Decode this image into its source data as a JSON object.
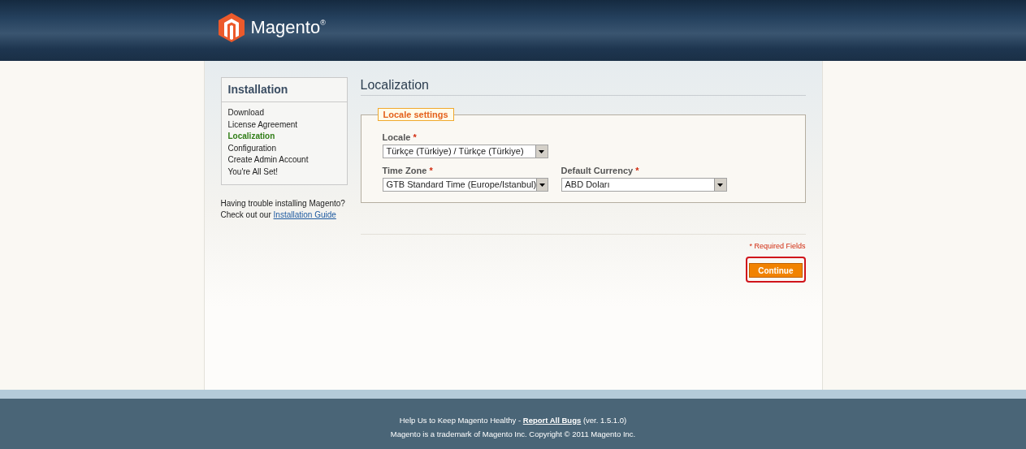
{
  "header": {
    "logo_text": "Magento",
    "logo_mark": "®"
  },
  "sidebar": {
    "title": "Installation",
    "steps": [
      {
        "label": "Download",
        "selected": false
      },
      {
        "label": "License Agreement",
        "selected": false
      },
      {
        "label": "Localization",
        "selected": true
      },
      {
        "label": "Configuration",
        "selected": false
      },
      {
        "label": "Create Admin Account",
        "selected": false
      },
      {
        "label": "You're All Set!",
        "selected": false
      }
    ],
    "help_text": "Having trouble installing Magento?",
    "help_prefix": "Check out our",
    "help_link": "Installation Guide"
  },
  "page_title": "Localization",
  "fieldset": {
    "legend": "Locale settings",
    "required_mark": "*",
    "fields": [
      {
        "label": "Locale",
        "required": true,
        "value": "Türkçe (Türkiye) / Türkçe (Türkiye)"
      },
      {
        "label": "Time Zone",
        "required": true,
        "value": "GTB Standard Time (Europe/Istanbul)"
      },
      {
        "label": "Default Currency",
        "required": true,
        "value": "ABD Doları"
      }
    ]
  },
  "required_note": "* Required Fields",
  "continue_button": {
    "label": "Continue",
    "highlighted": true
  },
  "footer": {
    "line1_before": "Help Us to Keep Magento Healthy -",
    "line1_link": "Report All Bugs",
    "line1_after": "(ver. 1.5.1.0)",
    "line2": "Magento is a trademark of Magento Inc. Copyright © 2011 Magento Inc."
  }
}
